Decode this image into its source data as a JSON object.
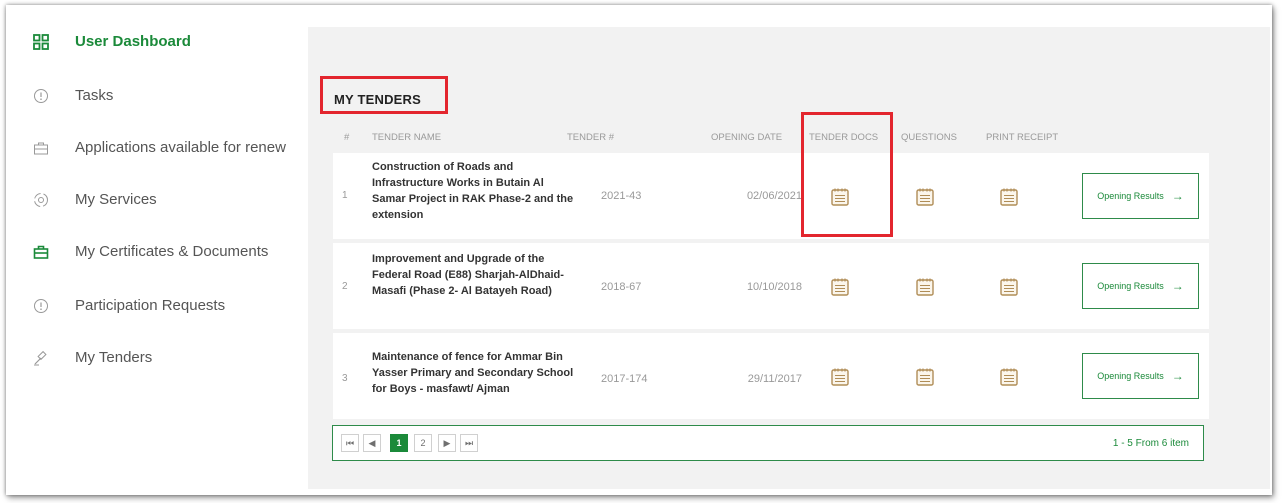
{
  "sidebar": {
    "items": [
      {
        "label": "User Dashboard",
        "icon": "dashboard-grid-icon",
        "active": true
      },
      {
        "label": "Tasks",
        "icon": "info-circle-icon"
      },
      {
        "label": "Applications available for renew",
        "icon": "briefcase-icon"
      },
      {
        "label": "My Services",
        "icon": "services-circle-icon"
      },
      {
        "label": "My Certificates & Documents",
        "icon": "briefcase-icon"
      },
      {
        "label": "Participation Requests",
        "icon": "info-circle-icon"
      },
      {
        "label": "My Tenders",
        "icon": "gavel-icon"
      }
    ]
  },
  "page": {
    "title": "MY TENDERS"
  },
  "table": {
    "headers": {
      "index": "#",
      "tender_name": "TENDER NAME",
      "tender_number": "TENDER #",
      "opening_date": "OPENING DATE",
      "tender_docs": "TENDER DOCS",
      "questions": "QUESTIONS",
      "print_receipt": "PRINT RECEIPT"
    },
    "rows": [
      {
        "index": "1",
        "name": "Construction of Roads and Infrastructure Works in Butain Al Samar Project in RAK Phase-2 and the extension",
        "number": "2021-43",
        "date": "02/06/2021",
        "action": "Opening Results"
      },
      {
        "index": "2",
        "name": "Improvement and Upgrade of the Federal Road (E88) Sharjah-AlDhaid-Masafi (Phase 2- Al Batayeh Road)",
        "number": "2018-67",
        "date": "10/10/2018",
        "action": "Opening Results"
      },
      {
        "index": "3",
        "name": "Maintenance of fence for Ammar Bin Yasser Primary and Secondary School for Boys - masfawt/ Ajman",
        "number": "2017-174",
        "date": "29/11/2017",
        "action": "Opening Results"
      }
    ]
  },
  "pagination": {
    "first": "⏮",
    "prev": "◀",
    "pages": [
      "1",
      "2"
    ],
    "current": "1",
    "next": "▶",
    "last": "⏭",
    "summary": "1 - 5 From 6 item"
  },
  "colors": {
    "accent_green": "#1b8a3a",
    "highlight_red": "#e3262e",
    "doc_icon": "#b08d57"
  }
}
